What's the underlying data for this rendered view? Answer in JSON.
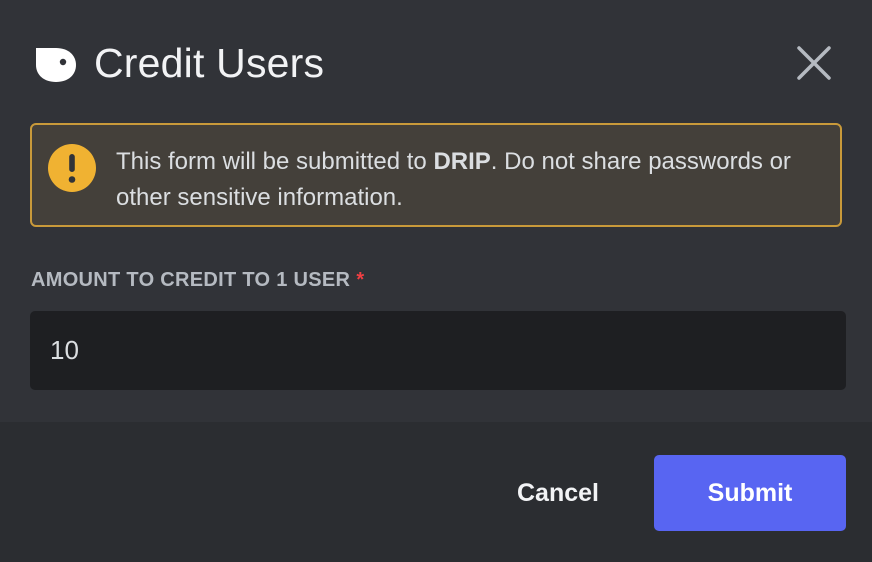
{
  "modal": {
    "title": "Credit Users",
    "app_icon": "drip-logo-icon",
    "close_icon": "close-icon"
  },
  "warning": {
    "icon": "warning-icon",
    "text_before": "This form will be submitted to ",
    "app_name": "DRIP",
    "text_after": ". Do not share passwords or other sensitive information.",
    "border_color": "#c99a3a",
    "background_color": "#44403a"
  },
  "field": {
    "label": "AMOUNT TO CREDIT TO 1 USER",
    "required_marker": "*",
    "value": "10"
  },
  "footer": {
    "cancel_label": "Cancel",
    "submit_label": "Submit"
  },
  "colors": {
    "background": "#313338",
    "footer_background": "#2b2d31",
    "input_background": "#1e1f22",
    "accent": "#5865f2",
    "required": "#f23f43",
    "warning_icon": "#f0b232"
  }
}
